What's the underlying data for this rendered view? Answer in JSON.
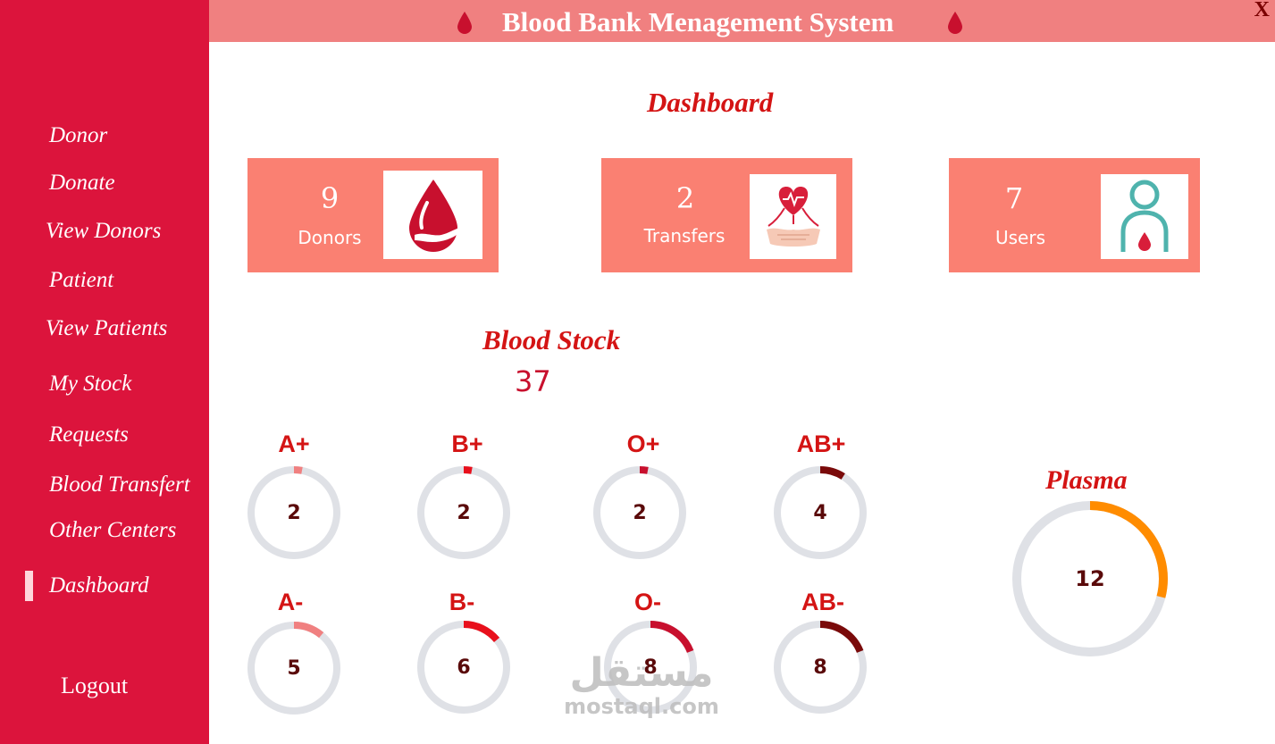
{
  "app": {
    "title": "Blood Bank Menagement System",
    "close_label": "X"
  },
  "sidebar": {
    "items": [
      {
        "label": "Donor"
      },
      {
        "label": "Donate"
      },
      {
        "label": "View Donors"
      },
      {
        "label": "Patient"
      },
      {
        "label": "View Patients"
      },
      {
        "label": "My Stock"
      },
      {
        "label": "Requests"
      },
      {
        "label": "Blood Transfert"
      },
      {
        "label": "Other Centers"
      },
      {
        "label": "Dashboard",
        "active": true
      }
    ],
    "logout_label": "Logout"
  },
  "dashboard": {
    "heading": "Dashboard",
    "cards": [
      {
        "value": "9",
        "label": "Donors",
        "icon": "blood-drop-hand-icon"
      },
      {
        "value": "2",
        "label": "Transfers",
        "icon": "heart-handshake-icon"
      },
      {
        "value": "7",
        "label": "Users",
        "icon": "user-blood-icon"
      }
    ],
    "stock_heading": "Blood Stock",
    "stock_total": "37",
    "plasma_heading": "Plasma"
  },
  "blood_groups": [
    {
      "group": "A+",
      "value": "2",
      "fill": 0.03,
      "color": "#f08080"
    },
    {
      "group": "B+",
      "value": "2",
      "fill": 0.03,
      "color": "#e8101c"
    },
    {
      "group": "O+",
      "value": "2",
      "fill": 0.03,
      "color": "#c8102e"
    },
    {
      "group": "AB+",
      "value": "4",
      "fill": 0.09,
      "color": "#7a0a0a"
    },
    {
      "group": "A-",
      "value": "5",
      "fill": 0.11,
      "color": "#f08080"
    },
    {
      "group": "B-",
      "value": "6",
      "fill": 0.14,
      "color": "#e8101c"
    },
    {
      "group": "O-",
      "value": "8",
      "fill": 0.19,
      "color": "#c8102e"
    },
    {
      "group": "AB-",
      "value": "8",
      "fill": 0.19,
      "color": "#7a0a0a"
    }
  ],
  "plasma": {
    "value": "12",
    "fill": 0.29,
    "color": "#ff8c00"
  },
  "gauge_track_color": "#dfe1e6",
  "watermark": {
    "logo": "مستقل",
    "url": "mostaql.com"
  }
}
